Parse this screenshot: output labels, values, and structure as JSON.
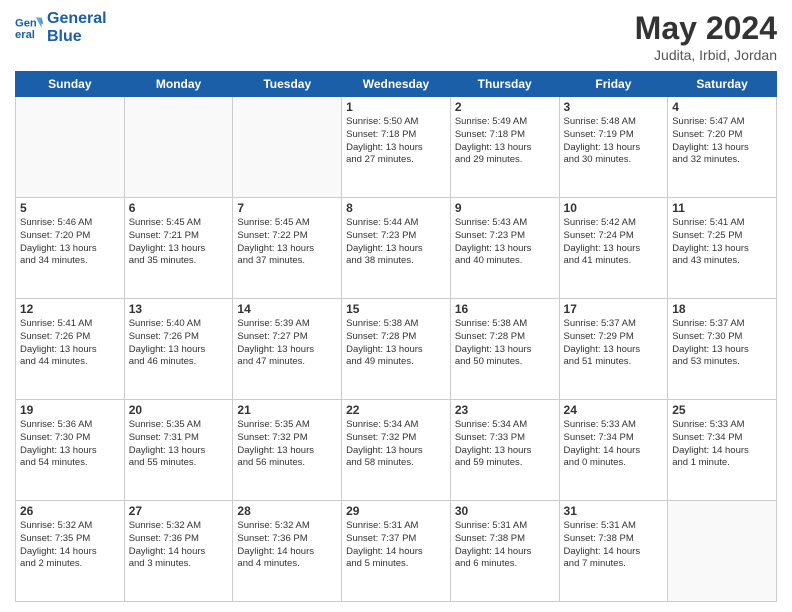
{
  "logo": {
    "line1": "General",
    "line2": "Blue"
  },
  "title": "May 2024",
  "location": "Judita, Irbid, Jordan",
  "days_of_week": [
    "Sunday",
    "Monday",
    "Tuesday",
    "Wednesday",
    "Thursday",
    "Friday",
    "Saturday"
  ],
  "weeks": [
    [
      {
        "day": "",
        "info": ""
      },
      {
        "day": "",
        "info": ""
      },
      {
        "day": "",
        "info": ""
      },
      {
        "day": "1",
        "info": "Sunrise: 5:50 AM\nSunset: 7:18 PM\nDaylight: 13 hours\nand 27 minutes."
      },
      {
        "day": "2",
        "info": "Sunrise: 5:49 AM\nSunset: 7:18 PM\nDaylight: 13 hours\nand 29 minutes."
      },
      {
        "day": "3",
        "info": "Sunrise: 5:48 AM\nSunset: 7:19 PM\nDaylight: 13 hours\nand 30 minutes."
      },
      {
        "day": "4",
        "info": "Sunrise: 5:47 AM\nSunset: 7:20 PM\nDaylight: 13 hours\nand 32 minutes."
      }
    ],
    [
      {
        "day": "5",
        "info": "Sunrise: 5:46 AM\nSunset: 7:20 PM\nDaylight: 13 hours\nand 34 minutes."
      },
      {
        "day": "6",
        "info": "Sunrise: 5:45 AM\nSunset: 7:21 PM\nDaylight: 13 hours\nand 35 minutes."
      },
      {
        "day": "7",
        "info": "Sunrise: 5:45 AM\nSunset: 7:22 PM\nDaylight: 13 hours\nand 37 minutes."
      },
      {
        "day": "8",
        "info": "Sunrise: 5:44 AM\nSunset: 7:23 PM\nDaylight: 13 hours\nand 38 minutes."
      },
      {
        "day": "9",
        "info": "Sunrise: 5:43 AM\nSunset: 7:23 PM\nDaylight: 13 hours\nand 40 minutes."
      },
      {
        "day": "10",
        "info": "Sunrise: 5:42 AM\nSunset: 7:24 PM\nDaylight: 13 hours\nand 41 minutes."
      },
      {
        "day": "11",
        "info": "Sunrise: 5:41 AM\nSunset: 7:25 PM\nDaylight: 13 hours\nand 43 minutes."
      }
    ],
    [
      {
        "day": "12",
        "info": "Sunrise: 5:41 AM\nSunset: 7:26 PM\nDaylight: 13 hours\nand 44 minutes."
      },
      {
        "day": "13",
        "info": "Sunrise: 5:40 AM\nSunset: 7:26 PM\nDaylight: 13 hours\nand 46 minutes."
      },
      {
        "day": "14",
        "info": "Sunrise: 5:39 AM\nSunset: 7:27 PM\nDaylight: 13 hours\nand 47 minutes."
      },
      {
        "day": "15",
        "info": "Sunrise: 5:38 AM\nSunset: 7:28 PM\nDaylight: 13 hours\nand 49 minutes."
      },
      {
        "day": "16",
        "info": "Sunrise: 5:38 AM\nSunset: 7:28 PM\nDaylight: 13 hours\nand 50 minutes."
      },
      {
        "day": "17",
        "info": "Sunrise: 5:37 AM\nSunset: 7:29 PM\nDaylight: 13 hours\nand 51 minutes."
      },
      {
        "day": "18",
        "info": "Sunrise: 5:37 AM\nSunset: 7:30 PM\nDaylight: 13 hours\nand 53 minutes."
      }
    ],
    [
      {
        "day": "19",
        "info": "Sunrise: 5:36 AM\nSunset: 7:30 PM\nDaylight: 13 hours\nand 54 minutes."
      },
      {
        "day": "20",
        "info": "Sunrise: 5:35 AM\nSunset: 7:31 PM\nDaylight: 13 hours\nand 55 minutes."
      },
      {
        "day": "21",
        "info": "Sunrise: 5:35 AM\nSunset: 7:32 PM\nDaylight: 13 hours\nand 56 minutes."
      },
      {
        "day": "22",
        "info": "Sunrise: 5:34 AM\nSunset: 7:32 PM\nDaylight: 13 hours\nand 58 minutes."
      },
      {
        "day": "23",
        "info": "Sunrise: 5:34 AM\nSunset: 7:33 PM\nDaylight: 13 hours\nand 59 minutes."
      },
      {
        "day": "24",
        "info": "Sunrise: 5:33 AM\nSunset: 7:34 PM\nDaylight: 14 hours\nand 0 minutes."
      },
      {
        "day": "25",
        "info": "Sunrise: 5:33 AM\nSunset: 7:34 PM\nDaylight: 14 hours\nand 1 minute."
      }
    ],
    [
      {
        "day": "26",
        "info": "Sunrise: 5:32 AM\nSunset: 7:35 PM\nDaylight: 14 hours\nand 2 minutes."
      },
      {
        "day": "27",
        "info": "Sunrise: 5:32 AM\nSunset: 7:36 PM\nDaylight: 14 hours\nand 3 minutes."
      },
      {
        "day": "28",
        "info": "Sunrise: 5:32 AM\nSunset: 7:36 PM\nDaylight: 14 hours\nand 4 minutes."
      },
      {
        "day": "29",
        "info": "Sunrise: 5:31 AM\nSunset: 7:37 PM\nDaylight: 14 hours\nand 5 minutes."
      },
      {
        "day": "30",
        "info": "Sunrise: 5:31 AM\nSunset: 7:38 PM\nDaylight: 14 hours\nand 6 minutes."
      },
      {
        "day": "31",
        "info": "Sunrise: 5:31 AM\nSunset: 7:38 PM\nDaylight: 14 hours\nand 7 minutes."
      },
      {
        "day": "",
        "info": ""
      }
    ]
  ]
}
